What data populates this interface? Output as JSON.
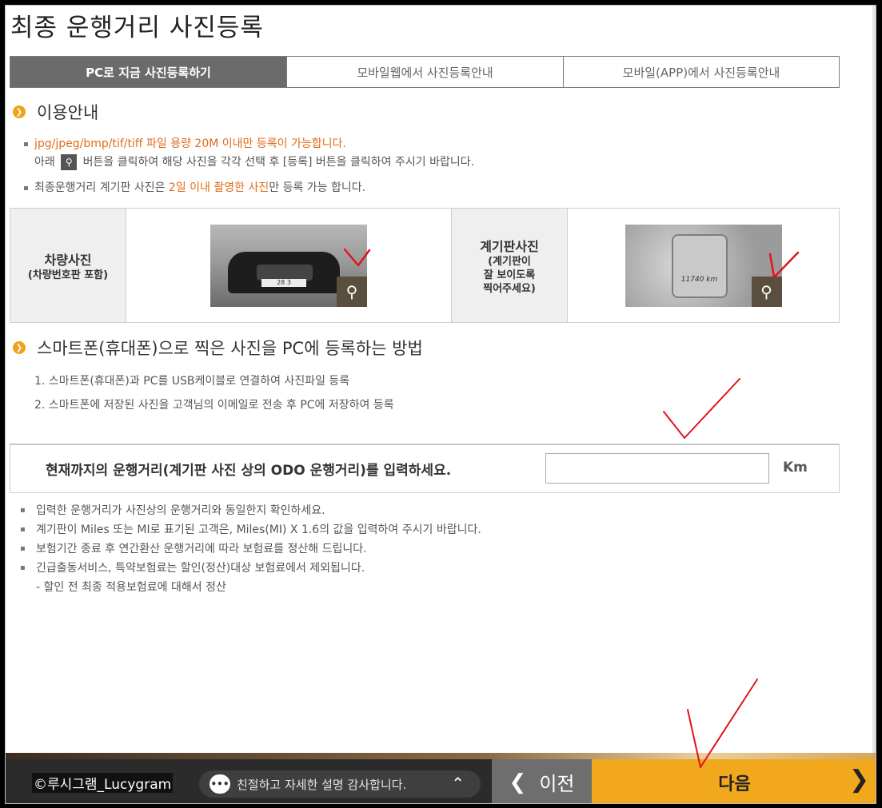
{
  "page_title": "최종 운행거리 사진등록",
  "tabs": [
    {
      "label": "PC로 지금 사진등록하기"
    },
    {
      "label": "모바일웹에서 사진등록안내"
    },
    {
      "label": "모바일(APP)에서 사진등록안내"
    }
  ],
  "guide": {
    "heading": "이용안내",
    "note1_orange": "jpg/jpeg/bmp/tif/tiff 파일 용량 20M 이내만 등록이 가능합니다.",
    "note1_line2_prefix": "아래",
    "note1_line2_suffix": "버튼을 클릭하여 해당 사진을 각각 선택 후 [등록] 버튼을 클릭하여 주시기 바랍니다.",
    "note2_prefix": "최종운행거리 계기판 사진은",
    "note2_highlight": "2일 이내 촬영한 사진",
    "note2_suffix": "만 등록 가능 합니다."
  },
  "photos": {
    "car_label": "차량사진",
    "car_sub": "(차량번호판 포함)",
    "car_plate": "28 3",
    "dash_label": "계기판사진",
    "dash_sub1": "(계기판이",
    "dash_sub2": "잘 보이도록",
    "dash_sub3": "찍어주세요)",
    "dash_reading": "11740 km"
  },
  "howto": {
    "heading": "스마트폰(휴대폰)으로 찍은 사진을 PC에 등록하는 방법",
    "step1": "1. 스마트폰(휴대폰)과 PC를 USB케이블로 연결하여 사진파일 등록",
    "step2": "2. 스마트폰에 저장된 사진을 고객님의 이메일로 전송 후 PC에 저장하여 등록"
  },
  "odo": {
    "label": "현재까지의 운행거리(계기판 사진 상의 ODO 운행거리)를 입력하세요.",
    "value": "",
    "unit": "Km"
  },
  "info": {
    "line1": "입력한 운행거리가 사진상의 운행거리와 동일한지 확인하세요.",
    "line2": "계기판이 Miles 또는 MI로 표기된 고객은, Miles(MI) X 1.6의 값을 입력하여 주시기 바랍니다.",
    "line3": "보험기간 종료 후 연간환산 운행거리에 따라 보험료를 정산해 드립니다.",
    "line4": "긴급출동서비스, 특약보험료는 할인(정산)대상 보험료에서 제외됩니다.",
    "line5": "- 할인 전 최종 적용보험료에 대해서 정산"
  },
  "bottom": {
    "credit": "©루시그램_Lucygram",
    "comment": "친절하고 자세한 설명 감사합니다.",
    "prev_label": "이전",
    "next_label": "다음"
  },
  "colors": {
    "accent_orange": "#f2a81c",
    "highlight_text": "#e26b17",
    "active_tab": "#6b6b6b",
    "annotation_red": "#e0141e"
  }
}
